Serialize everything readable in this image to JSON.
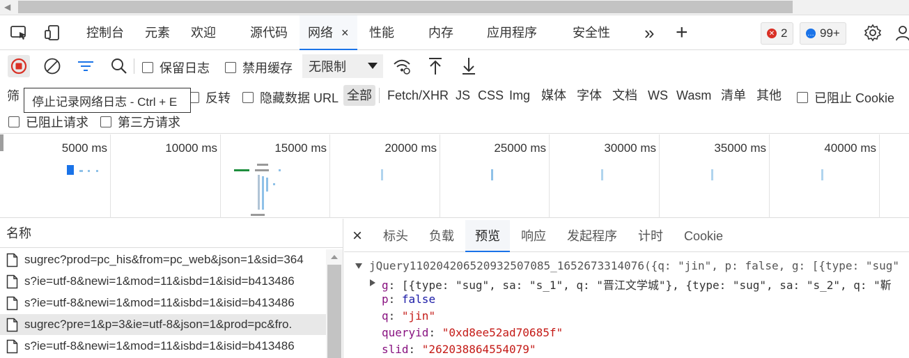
{
  "tabs": {
    "items": [
      "控制台",
      "元素",
      "欢迎",
      "源代码",
      "网络",
      "性能",
      "内存",
      "应用程序",
      "安全性"
    ],
    "active": "网络",
    "close": "×",
    "more": "»",
    "add": "+"
  },
  "badges": {
    "errors": "2",
    "messages": "99+"
  },
  "toolbar": {
    "preserve_log": "保留日志",
    "disable_cache": "禁用缓存",
    "throttle": "无限制"
  },
  "tooltip": "停止记录网络日志 - Ctrl + E",
  "filter": {
    "label": "筛",
    "invert": "反转",
    "hide_data_url": "隐藏数据 URL",
    "types": [
      "全部",
      "Fetch/XHR",
      "JS",
      "CSS",
      "Img",
      "媒体",
      "字体",
      "文档",
      "WS",
      "Wasm",
      "清单",
      "其他"
    ],
    "active_type": "全部",
    "blocked_cookies": "已阻止 Cookie",
    "blocked_requests": "已阻止请求",
    "third_party": "第三方请求"
  },
  "overview": {
    "ticks": [
      "5000 ms",
      "10000 ms",
      "15000 ms",
      "20000 ms",
      "25000 ms",
      "30000 ms",
      "35000 ms",
      "40000 ms"
    ]
  },
  "names": {
    "header": "名称",
    "rows": [
      "sugrec?prod=pc_his&from=pc_web&json=1&sid=364",
      "s?ie=utf-8&newi=1&mod=11&isbd=1&isid=b413486",
      "s?ie=utf-8&newi=1&mod=11&isbd=1&isid=b413486",
      "sugrec?pre=1&p=3&ie=utf-8&json=1&prod=pc&fro.",
      "s?ie=utf-8&newi=1&mod=11&isbd=1&isid=b413486"
    ],
    "selected_index": 3
  },
  "detail": {
    "close": "×",
    "tabs": [
      "标头",
      "负载",
      "预览",
      "响应",
      "发起程序",
      "计时",
      "Cookie"
    ],
    "active": "预览",
    "preview": {
      "root": "jQuery110204206520932507085_1652673314076({q: \"jin\", p: false, g: [{type: \"sug\"",
      "g_key": "g",
      "g_val": "[{type: \"sug\", sa: \"s_1\", q: \"晋江文学城\"}, {type: \"sug\", sa: \"s_2\", q: \"靳",
      "p_key": "p",
      "p_val": "false",
      "q_key": "q",
      "q_val": "\"jin\"",
      "queryid_key": "queryid",
      "queryid_val": "\"0xd8ee52ad70685f\"",
      "slid_key": "slid",
      "slid_val": "\"262038864554079\""
    }
  }
}
